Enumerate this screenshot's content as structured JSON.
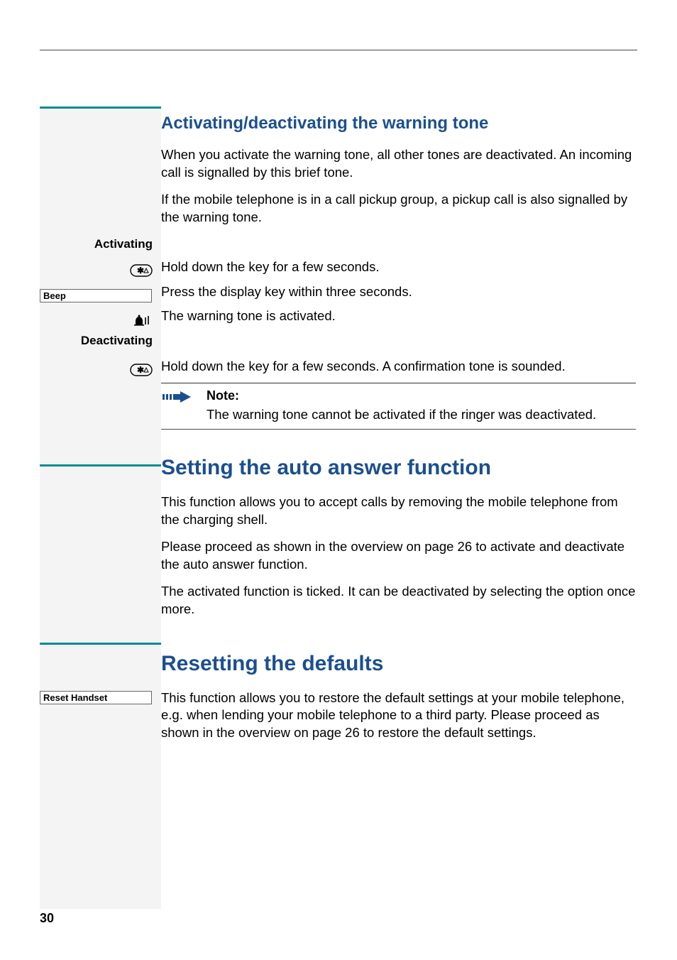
{
  "page_number": "30",
  "section1": {
    "heading": "Activating/deactivating the warning tone",
    "p1": "When you activate the warning tone, all other tones are deactivated. An incoming call is signalled by this brief tone.",
    "p2": "If the mobile telephone is in a call pickup group, a pickup call is also signalled by the warning tone.",
    "activating_label": "Activating",
    "step_a1": "Hold down the key for a few seconds.",
    "beep_box": "Beep",
    "step_a2": "Press the display key within three seconds.",
    "step_a3": "The warning tone is activated.",
    "deactivating_label": "Deactivating",
    "step_d1": "Hold down the key for a few seconds. A confirmation tone is sounded.",
    "note_title": "Note:",
    "note_body": "The warning tone cannot be activated if the ringer was deactivated."
  },
  "section2": {
    "heading": "Setting the auto answer function",
    "p1": "This function allows you to accept calls by removing the mobile telephone from the charging shell.",
    "p2": "Please proceed as shown in the overview on page 26 to activate and deactivate the auto answer function.",
    "p3": "The activated function is ticked. It can be deactivated by selecting the option once more."
  },
  "section3": {
    "heading": "Resetting the defaults",
    "reset_box": "Reset Handset",
    "p1": "This function allows you to restore the default settings at your mobile telephone, e.g. when lending your mobile telephone to a third party. Please proceed as shown in the overview on page 26 to restore the default settings."
  }
}
